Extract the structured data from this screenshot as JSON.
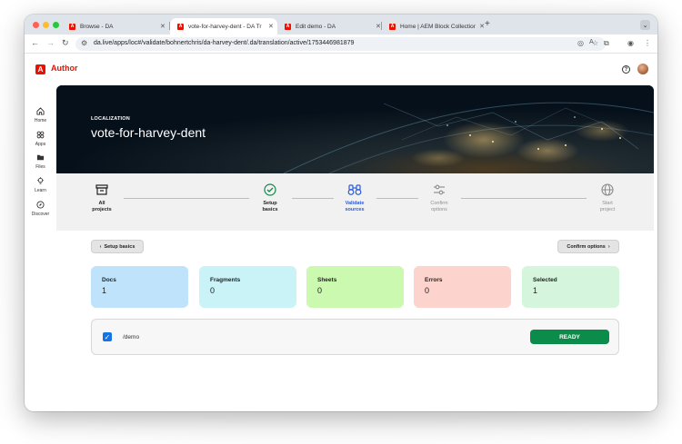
{
  "browser": {
    "tabs": [
      {
        "title": "Browse - DA",
        "active": false
      },
      {
        "title": "vote-for-harvey-dent - DA Tr",
        "active": true
      },
      {
        "title": "Edit demo - DA",
        "active": false
      },
      {
        "title": "Home | AEM Block Collection",
        "active": false
      }
    ],
    "url": "da.live/apps/loc#/validate/bohnertchris/da-harvey-dent/.da/translation/active/1753446981879"
  },
  "app": {
    "name": "Author",
    "logo_letter": "A",
    "brand_color": "#eb1000"
  },
  "sidebar": {
    "items": [
      {
        "label": "Home",
        "icon": "home-icon"
      },
      {
        "label": "Apps",
        "icon": "apps-icon"
      },
      {
        "label": "Files",
        "icon": "folder-icon"
      },
      {
        "label": "Learn",
        "icon": "lightbulb-icon"
      },
      {
        "label": "Discover",
        "icon": "compass-icon"
      }
    ]
  },
  "hero": {
    "eyebrow": "LOCALIZATION",
    "title": "vote-for-harvey-dent"
  },
  "steps": [
    {
      "line1": "All",
      "line2": "projects",
      "state": "done",
      "icon": "archive-icon"
    },
    {
      "line1": "Setup",
      "line2": "basics",
      "state": "done",
      "icon": "check-circle-icon"
    },
    {
      "line1": "Validate",
      "line2": "sources",
      "state": "active",
      "icon": "binoculars-icon"
    },
    {
      "line1": "Confirm",
      "line2": "options",
      "state": "todo",
      "icon": "sliders-icon"
    },
    {
      "line1": "Start",
      "line2": "project",
      "state": "todo",
      "icon": "globe-icon"
    }
  ],
  "actions": {
    "back_label": "Setup basics",
    "next_label": "Confirm options"
  },
  "stats": [
    {
      "label": "Docs",
      "value": "1",
      "color": "#bfe3fb"
    },
    {
      "label": "Fragments",
      "value": "0",
      "color": "#c9f3f7"
    },
    {
      "label": "Sheets",
      "value": "0",
      "color": "#ccf9b0"
    },
    {
      "label": "Errors",
      "value": "0",
      "color": "#fdd3ce"
    },
    {
      "label": "Selected",
      "value": "1",
      "color": "#d5f6dc"
    }
  ],
  "sources": [
    {
      "path": "/demo",
      "checked": true,
      "status": "READY",
      "status_color": "#0c8c4a"
    }
  ]
}
